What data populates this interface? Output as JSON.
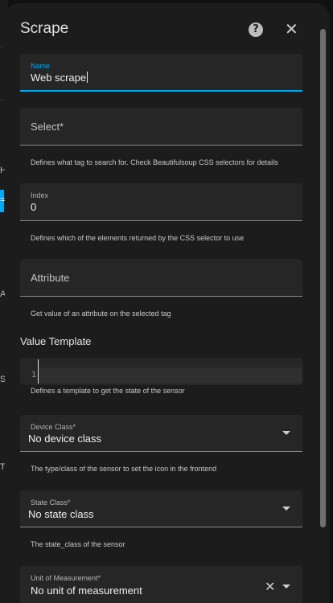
{
  "background": {
    "glyphs": [
      "H",
      "=",
      "A",
      "S",
      "T"
    ]
  },
  "dialog": {
    "title": "Scrape",
    "help_icon_glyph": "?",
    "close_icon_glyph": "✕"
  },
  "fields": {
    "name": {
      "label": "Name",
      "value": "Web scrape"
    },
    "select": {
      "placeholder": "Select*",
      "helper": "Defines what tag to search for. Check Beautifulsoup CSS selectors for details"
    },
    "index": {
      "label": "Index",
      "value": "0",
      "helper": "Defines which of the elements returned by the CSS selector to use"
    },
    "attribute": {
      "placeholder": "Attribute",
      "helper": "Get value of an attribute on the selected tag"
    },
    "value_template": {
      "title": "Value Template",
      "line_number": "1",
      "helper": "Defines a template to get the state of the sensor"
    },
    "device_class": {
      "label": "Device Class*",
      "value": "No device class",
      "helper": "The type/class of the sensor to set the icon in the frontend"
    },
    "state_class": {
      "label": "State Class*",
      "value": "No state class",
      "helper": "The state_class of the sensor"
    },
    "unit_of_measurement": {
      "label": "Unit of Measurement*",
      "value": "No unit of measurement",
      "clear_glyph": "✕"
    }
  },
  "colors": {
    "accent": "#03a9f4",
    "dialog_bg": "#1c1c1c",
    "field_bg": "#262626"
  }
}
